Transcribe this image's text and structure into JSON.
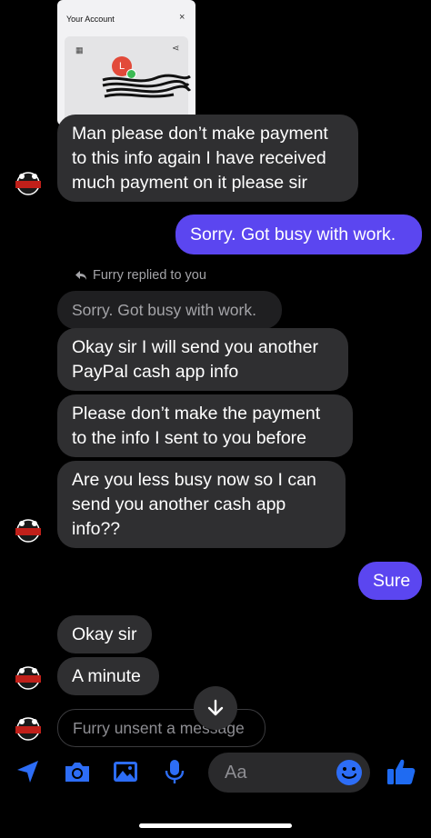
{
  "shared_card": {
    "title": "Your Account",
    "close": "×",
    "avatar_initial": "L"
  },
  "messages": {
    "m1": "Man please don’t make payment\nto this info again I have received\nmuch payment on it please sir",
    "m2": "Sorry. Got busy with work.",
    "reply_label": "Furry replied to you",
    "quoted": "Sorry. Got busy with work.",
    "m3": "Okay sir I will send you another\nPayPal cash app info",
    "m4": "Please don’t make the payment\nto the info I sent to you before",
    "m5": "Are you less busy now so I can\nsend you another cash app\ninfo??",
    "m6": "Sure",
    "m7": "Okay sir",
    "m8": "A minute",
    "unsent": "Furry unsent a message"
  },
  "composer": {
    "placeholder": "Aa"
  },
  "colors": {
    "background": "#000000",
    "incoming_bubble": "#2f2f31",
    "outgoing_bubble": "#5b46f0",
    "accent_icon": "#2d6df6",
    "like_icon": "#1f6bf2"
  }
}
